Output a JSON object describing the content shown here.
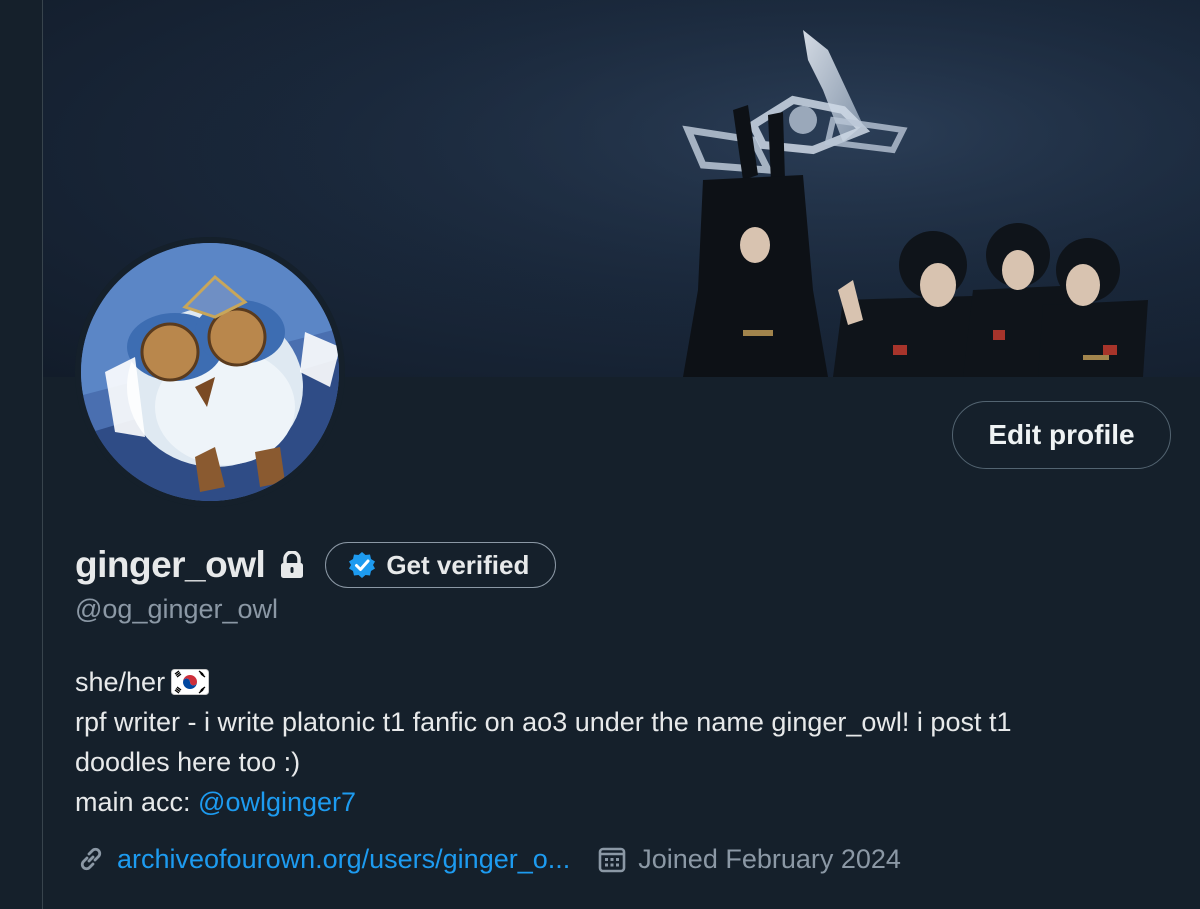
{
  "profile": {
    "display_name": "ginger_owl",
    "handle": "@og_ginger_owl",
    "edit_button_label": "Edit profile",
    "verify_button_label": "Get verified",
    "bio": {
      "line1": "she/her",
      "line2": "rpf writer - i write platonic t1 fanfic on ao3 under the name ginger_owl! i post t1",
      "line3": "doodles here too :)",
      "line4_prefix": "main acc: ",
      "line4_mention": "@owlginger7"
    },
    "website": "archiveofourown.org/users/ginger_o...",
    "joined": "Joined February 2024"
  },
  "icons": {
    "lock": "lock-icon",
    "verified_badge": "verified-badge-icon",
    "flag": "south-korea-flag-icon",
    "link": "link-icon",
    "calendar": "calendar-icon"
  },
  "colors": {
    "background": "#15202b",
    "accent": "#1d9bf0",
    "secondary_text": "#8b98a5",
    "primary_text": "#e7e9ea"
  }
}
